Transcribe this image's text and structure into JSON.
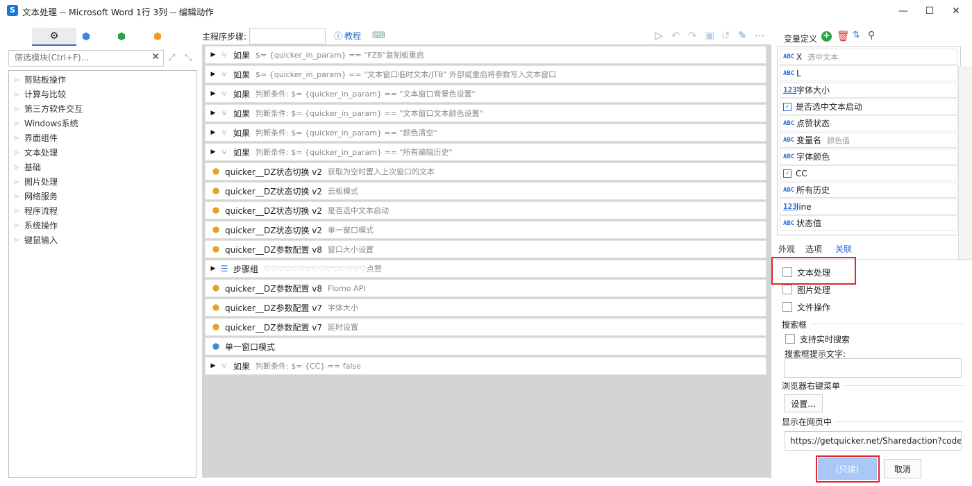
{
  "window": {
    "title": "文本处理 -- Microsoft Word 1行 3列 -- 编辑动作",
    "app_icon_glyph": "S",
    "controls": {
      "minimize": "—",
      "maximize": "☐",
      "close": "✕"
    }
  },
  "left_panel": {
    "tab_icons": [
      "gear-icon",
      "blue-cubes-icon",
      "green-cubes-icon",
      "orange-cubes-icon"
    ],
    "filter_placeholder": "筛选模块(Ctrl+F)...",
    "tree_items": [
      "剪贴板操作",
      "计算与比较",
      "第三方软件交互",
      "Windows系统",
      "界面组件",
      "文本处理",
      "基础",
      "图片处理",
      "网络服务",
      "程序流程",
      "系统操作",
      "键鼠输入"
    ]
  },
  "toolbar": {
    "main_steps_label": "主程序步骤:",
    "tutorial_label": "教程"
  },
  "steps": [
    {
      "arrow": "▶",
      "icon": "if",
      "name": "如果",
      "desc": "$= {quicker_in_param} == \"FZB\"复制板重启"
    },
    {
      "arrow": "▶",
      "icon": "if",
      "name": "如果",
      "desc": "$= {quicker_in_param} == \"文本窗口临时文本/JTB\"  外部或重启将参数写入文本窗口"
    },
    {
      "arrow": "▶",
      "icon": "if",
      "name": "如果",
      "desc": "判断条件: $= {quicker_in_param} == \"文本窗口背景色设置\""
    },
    {
      "arrow": "▶",
      "icon": "if",
      "name": "如果",
      "desc": "判断条件: $= {quicker_in_param} == \"文本窗口文本颜色设置\""
    },
    {
      "arrow": "▶",
      "icon": "if",
      "name": "如果",
      "desc": "判断条件: $= {quicker_in_param} == \"颜色清空\""
    },
    {
      "arrow": "▶",
      "icon": "if",
      "name": "如果",
      "desc": "判断条件: $= {quicker_in_param} == \"所有编辑历史\""
    },
    {
      "arrow": "",
      "icon": "sub",
      "name": "quicker__DZ状态切换 v2",
      "desc": "获取为空时置入上次窗口的文本"
    },
    {
      "arrow": "",
      "icon": "sub",
      "name": "quicker__DZ状态切换 v2",
      "desc": "云板模式"
    },
    {
      "arrow": "",
      "icon": "sub",
      "name": "quicker__DZ状态切换 v2",
      "desc": "是否选中文本启动"
    },
    {
      "arrow": "",
      "icon": "sub",
      "name": "quicker__DZ状态切换 v2",
      "desc": "单一窗口模式"
    },
    {
      "arrow": "",
      "icon": "sub",
      "name": "quicker__DZ参数配置 v8",
      "desc": "窗口大小设置"
    },
    {
      "arrow": "▶",
      "icon": "group",
      "name": "步骤组",
      "desc": "♡♡♡♡♡♡♡♡♡♡♡♡♡♡♡点赞"
    },
    {
      "arrow": "",
      "icon": "sub",
      "name": "quicker__DZ参数配置 v8",
      "desc": "Flomo API"
    },
    {
      "arrow": "",
      "icon": "sub",
      "name": "quicker__DZ参数配置 v7",
      "desc": "字体大小"
    },
    {
      "arrow": "",
      "icon": "sub",
      "name": "quicker__DZ参数配置 v7",
      "desc": "延时设置"
    },
    {
      "arrow": "",
      "icon": "blue",
      "name": "单一窗口模式",
      "desc": ""
    },
    {
      "arrow": "▶",
      "icon": "if",
      "name": "如果",
      "desc": "判断条件: $= {CC} == false"
    }
  ],
  "variables": {
    "header_label": "变量定义",
    "items": [
      {
        "type": "ABC",
        "name": "X",
        "desc": "选中文本"
      },
      {
        "type": "ABC",
        "name": "L",
        "desc": ""
      },
      {
        "type": "123",
        "name": "字体大小",
        "desc": ""
      },
      {
        "type": "✓",
        "name": "是否选中文本启动",
        "desc": ""
      },
      {
        "type": "ABC",
        "name": "点赞状态",
        "desc": ""
      },
      {
        "type": "ABC",
        "name": "变量名",
        "desc": "颜色值"
      },
      {
        "type": "ABC",
        "name": "字体颜色",
        "desc": ""
      },
      {
        "type": "✓",
        "name": "CC",
        "desc": ""
      },
      {
        "type": "ABC",
        "name": "所有历史",
        "desc": ""
      },
      {
        "type": "123",
        "name": "line",
        "desc": ""
      },
      {
        "type": "ABC",
        "name": "状态值",
        "desc": ""
      }
    ]
  },
  "right_tabs": [
    "外观",
    "选项",
    "关联"
  ],
  "association": {
    "checkboxes": [
      "文本处理",
      "图片处理",
      "文件操作"
    ],
    "search_box_section": "搜索框",
    "realtime_search_label": "支持实时搜索",
    "hint_text_label": "搜索框提示文字:",
    "browser_menu_section": "浏览器右键菜单",
    "settings_button": "设置...",
    "show_in_web_section": "显示在网页中",
    "url_value": "https://getquicker.net/Sharedaction?code"
  },
  "footer": {
    "readonly_button": "(只读)",
    "cancel_button": "取消"
  },
  "colors": {
    "accent": "#2a6cd6",
    "highlight_box": "#e0262b"
  }
}
